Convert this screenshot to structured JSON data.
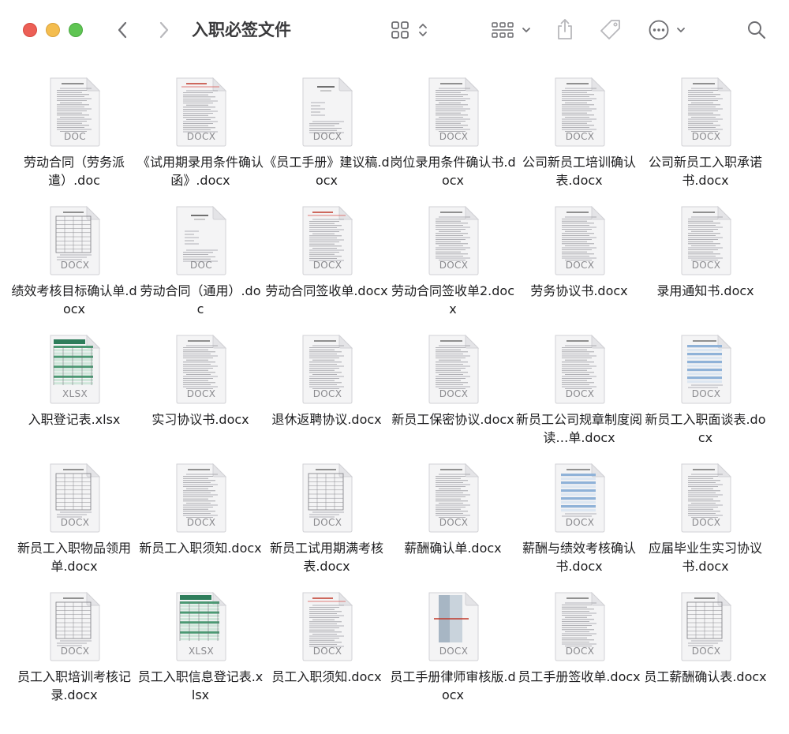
{
  "window": {
    "title": "入职必签文件"
  },
  "toolbar": {
    "back_icon": "chevron-left-icon",
    "forward_icon": "chevron-right-icon",
    "view_icon": "icon-grid-view-icon",
    "group_icon": "group-by-icon",
    "share_icon": "share-icon",
    "tag_icon": "tag-icon",
    "more_icon": "ellipsis-circle-icon",
    "search_icon": "search-icon"
  },
  "colors": {
    "close": "#ec5f56",
    "minimize": "#f4bd4f",
    "maximize": "#5fc553",
    "toolbar_icon": "#6e6e72",
    "text": "#1d1d1f"
  },
  "files": [
    {
      "name": "劳动合同（劳务派遣）.doc",
      "ext": "DOC",
      "kind": "doc"
    },
    {
      "name": "《试用期录用条件确认函》.docx",
      "ext": "DOCX",
      "kind": "doc-red"
    },
    {
      "name": "《员工手册》建议稿.docx",
      "ext": "DOCX",
      "kind": "doc-sparse"
    },
    {
      "name": "岗位录用条件确认书.docx",
      "ext": "DOCX",
      "kind": "doc"
    },
    {
      "name": "公司新员工培训确认表.docx",
      "ext": "DOCX",
      "kind": "doc"
    },
    {
      "name": "公司新员工入职承诺书.docx",
      "ext": "DOCX",
      "kind": "doc"
    },
    {
      "name": "绩效考核目标确认单.docx",
      "ext": "DOCX",
      "kind": "doc-table"
    },
    {
      "name": "劳动合同（通用）.doc",
      "ext": "DOC",
      "kind": "doc-sparse"
    },
    {
      "name": "劳动合同签收单.docx",
      "ext": "DOCX",
      "kind": "doc-red"
    },
    {
      "name": "劳动合同签收单2.docx",
      "ext": "DOCX",
      "kind": "doc"
    },
    {
      "name": "劳务协议书.docx",
      "ext": "DOCX",
      "kind": "doc"
    },
    {
      "name": "录用通知书.docx",
      "ext": "DOCX",
      "kind": "doc"
    },
    {
      "name": "入职登记表.xlsx",
      "ext": "XLSX",
      "kind": "xlsx"
    },
    {
      "name": "实习协议书.docx",
      "ext": "DOCX",
      "kind": "doc"
    },
    {
      "name": "退休返聘协议.docx",
      "ext": "DOCX",
      "kind": "doc"
    },
    {
      "name": "新员工保密协议.docx",
      "ext": "DOCX",
      "kind": "doc"
    },
    {
      "name": "新员工公司规章制度阅读…单.docx",
      "ext": "DOCX",
      "kind": "doc"
    },
    {
      "name": "新员工入职面谈表.docx",
      "ext": "DOCX",
      "kind": "doc-blue"
    },
    {
      "name": "新员工入职物品领用单.docx",
      "ext": "DOCX",
      "kind": "doc-table"
    },
    {
      "name": "新员工入职须知.docx",
      "ext": "DOCX",
      "kind": "doc"
    },
    {
      "name": "新员工试用期满考核表.docx",
      "ext": "DOCX",
      "kind": "doc-table"
    },
    {
      "name": "薪酬确认单.docx",
      "ext": "DOCX",
      "kind": "doc"
    },
    {
      "name": "薪酬与绩效考核确认书.docx",
      "ext": "DOCX",
      "kind": "doc-blue"
    },
    {
      "name": "应届毕业生实习协议书.docx",
      "ext": "DOCX",
      "kind": "doc"
    },
    {
      "name": "员工入职培训考核记录.docx",
      "ext": "DOCX",
      "kind": "doc-table"
    },
    {
      "name": "员工入职信息登记表.xlsx",
      "ext": "XLSX",
      "kind": "xlsx2"
    },
    {
      "name": "员工入职须知.docx",
      "ext": "DOCX",
      "kind": "doc-red"
    },
    {
      "name": "员工手册律师审核版.docx",
      "ext": "DOCX",
      "kind": "doc-cover"
    },
    {
      "name": "员工手册签收单.docx",
      "ext": "DOCX",
      "kind": "doc"
    },
    {
      "name": "员工薪酬确认表.docx",
      "ext": "DOCX",
      "kind": "doc-table"
    }
  ]
}
